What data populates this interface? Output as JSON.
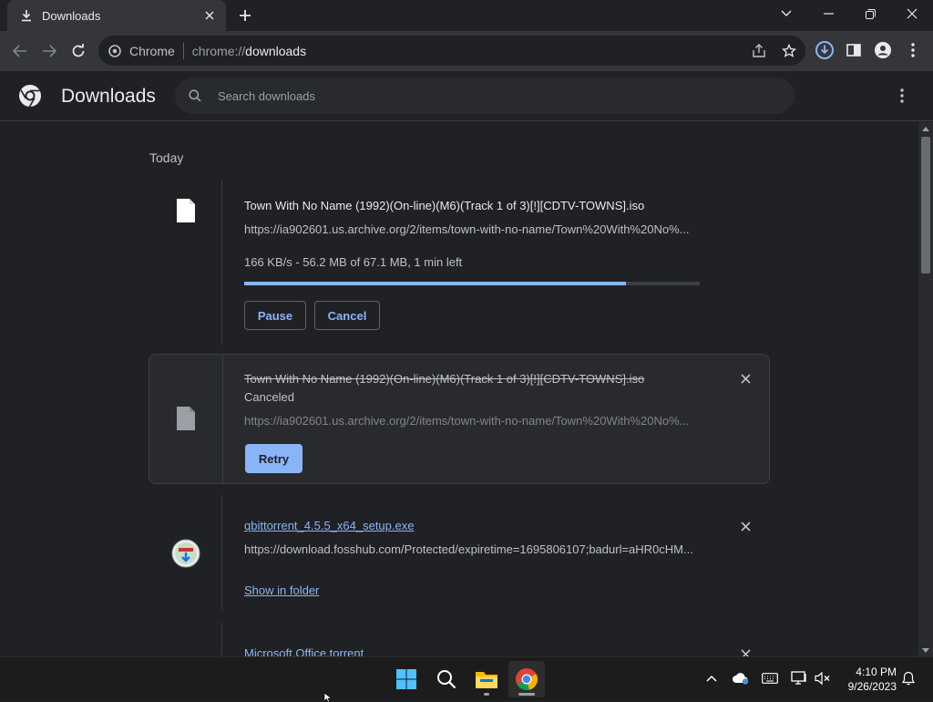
{
  "browser": {
    "tab": {
      "title": "Downloads",
      "icon": "download-icon",
      "close_icon": "close-icon"
    },
    "new_tab_icon": "plus-icon",
    "window_controls": [
      "chevron-down-icon",
      "minimize-icon",
      "restore-icon",
      "close-icon"
    ],
    "omnibox": {
      "chip_label": "Chrome",
      "url_scheme": "chrome://",
      "url_host": "downloads"
    }
  },
  "page": {
    "title": "Downloads",
    "search_placeholder": "Search downloads",
    "date_header": "Today",
    "downloads": [
      {
        "filename": "Town With No Name (1992)(On-line)(M6)(Track 1 of 3)[!][CDTV-TOWNS].iso",
        "url": "https://ia902601.us.archive.org/2/items/town-with-no-name/Town%20With%20No%...",
        "status": "166 KB/s - 56.2 MB of 67.1 MB, 1 min left",
        "progress_percent": 83.7,
        "pause_label": "Pause",
        "cancel_label": "Cancel",
        "state": "in_progress"
      },
      {
        "filename": "Town With No Name (1992)(On-line)(M6)(Track 1 of 3)[!][CDTV-TOWNS].iso",
        "status": "Canceled",
        "url": "https://ia902601.us.archive.org/2/items/town-with-no-name/Town%20With%20No%...",
        "retry_label": "Retry",
        "state": "canceled"
      },
      {
        "filename": "qbittorrent_4.5.5_x64_setup.exe",
        "url": "https://download.fosshub.com/Protected/expiretime=1695806107;badurl=aHR0cHM...",
        "show_in_folder_label": "Show in folder",
        "state": "complete"
      },
      {
        "filename": "Microsoft.Office.torrent",
        "state": "complete"
      }
    ]
  },
  "taskbar": {
    "apps": [
      "windows-start-icon",
      "search-icon",
      "file-explorer-icon",
      "chrome-icon"
    ],
    "clock_time": "4:10 PM",
    "clock_date": "9/26/2023"
  },
  "colors": {
    "accent": "#8ab4f8",
    "background": "#202124",
    "toolbar": "#35363a"
  }
}
